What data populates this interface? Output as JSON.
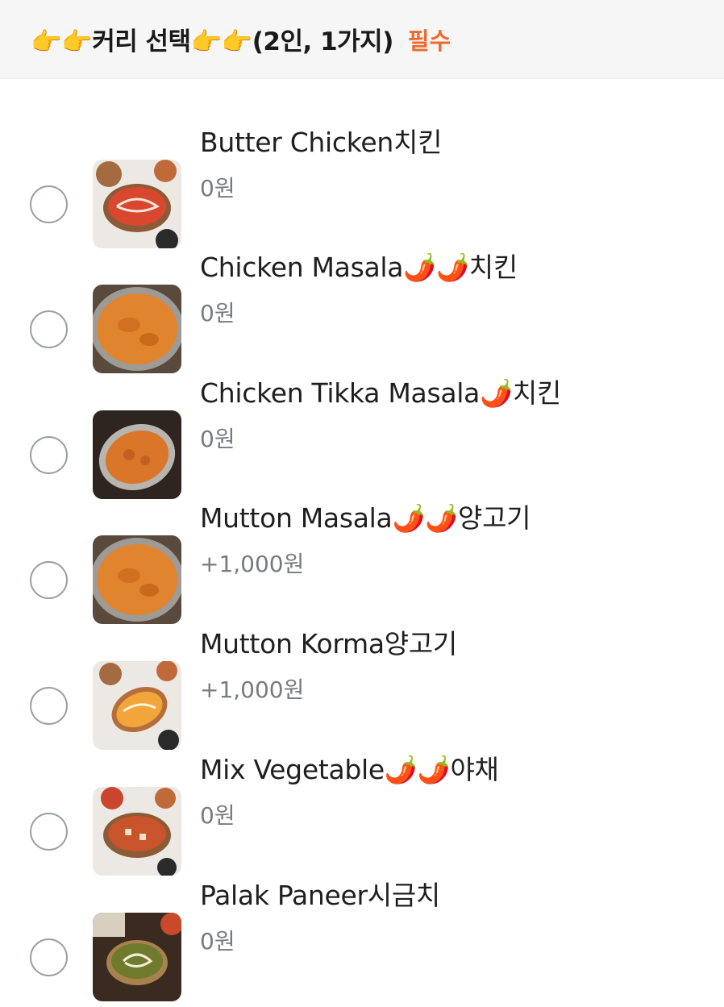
{
  "header": {
    "title": "👉👉커리 선택👉👉(2인, 1가지)",
    "badge": "필수"
  },
  "options": [
    {
      "name": "Butter Chicken치킨",
      "price": "0원",
      "thumb": "butter-chicken-image"
    },
    {
      "name": "Chicken Masala🌶️🌶️치킨",
      "price": "0원",
      "thumb": "chicken-masala-image"
    },
    {
      "name": "Chicken Tikka Masala🌶️치킨",
      "price": "0원",
      "thumb": "chicken-tikka-masala-image"
    },
    {
      "name": "Mutton Masala🌶️🌶️양고기",
      "price": "+1,000원",
      "thumb": "mutton-masala-image"
    },
    {
      "name": "Mutton Korma양고기",
      "price": "+1,000원",
      "thumb": "mutton-korma-image"
    },
    {
      "name": "Mix Vegetable🌶️🌶️야채",
      "price": "0원",
      "thumb": "mix-vegetable-image"
    },
    {
      "name": "Palak Paneer시금치",
      "price": "0원",
      "thumb": "palak-paneer-image"
    }
  ],
  "colors": {
    "accent": "#ef6a2c",
    "price_text": "#777b80",
    "radio_border": "#9a9fa5"
  }
}
